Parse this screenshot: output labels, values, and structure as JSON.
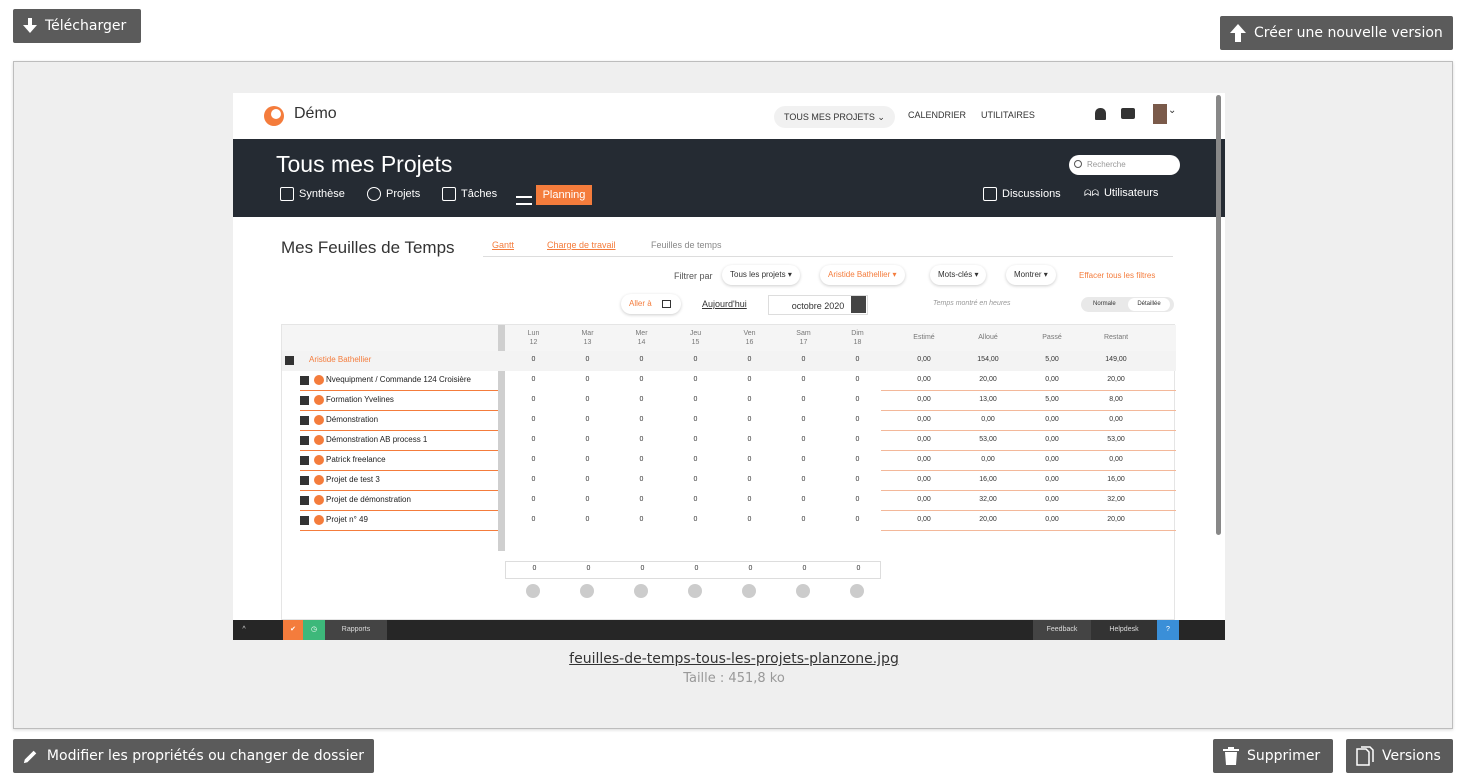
{
  "actions": {
    "download": "Télécharger",
    "new_version": "Créer une nouvelle version",
    "edit_props": "Modifier les propriétés ou changer de dossier",
    "delete": "Supprimer",
    "versions": "Versions"
  },
  "file": {
    "name": "feuilles-de-temps-tous-les-projets-planzone.jpg",
    "size": "Taille : 451,8 ko"
  },
  "preview": {
    "app_name": "Démo",
    "top_nav": {
      "projects": "TOUS MES PROJETS",
      "calendar": "CALENDRIER",
      "utilities": "UTILITAIRES"
    },
    "title": "Tous mes Projets",
    "search_placeholder": "Recherche",
    "nav": [
      "Synthèse",
      "Projets",
      "Tâches",
      "Planning"
    ],
    "nav_right": [
      "Discussions",
      "Utilisateurs"
    ],
    "section_title": "Mes Feuilles de Temps",
    "tabs": [
      "Gantt",
      "Charge de travail",
      "Feuilles de temps"
    ],
    "filter_label": "Filtrer par",
    "filters": [
      "Tous les projets",
      "Aristide Bathellier",
      "Mots-clés",
      "Montrer"
    ],
    "clear_filters": "Effacer tous les filtres",
    "goto": "Aller à",
    "today": "Aujourd'hui",
    "month": "octobre 2020",
    "time_note": "Temps montré en heures",
    "toggle": [
      "Normale",
      "Détaillée"
    ],
    "days": [
      {
        "d": "Lun",
        "n": "12"
      },
      {
        "d": "Mar",
        "n": "13"
      },
      {
        "d": "Mer",
        "n": "14"
      },
      {
        "d": "Jeu",
        "n": "15"
      },
      {
        "d": "Ven",
        "n": "16"
      },
      {
        "d": "Sam",
        "n": "17"
      },
      {
        "d": "Dim",
        "n": "18"
      }
    ],
    "sum_headers": [
      "Estimé",
      "Alloué",
      "Passé",
      "Restant"
    ],
    "owner": {
      "name": "Aristide Bathellier",
      "days": [
        "0",
        "0",
        "0",
        "0",
        "0",
        "0",
        "0"
      ],
      "sums": [
        "0,00",
        "154,00",
        "5,00",
        "149,00"
      ]
    },
    "rows": [
      {
        "name": "Nvequipment / Commande 124 Croisière",
        "sums": [
          "0,00",
          "20,00",
          "0,00",
          "20,00"
        ]
      },
      {
        "name": "Formation Yvelines",
        "sums": [
          "0,00",
          "13,00",
          "5,00",
          "8,00"
        ]
      },
      {
        "name": "Démonstration",
        "sums": [
          "0,00",
          "0,00",
          "0,00",
          "0,00"
        ]
      },
      {
        "name": "Démonstration AB process 1",
        "sums": [
          "0,00",
          "53,00",
          "0,00",
          "53,00"
        ]
      },
      {
        "name": "Patrick freelance",
        "sums": [
          "0,00",
          "0,00",
          "0,00",
          "0,00"
        ]
      },
      {
        "name": "Projet de test 3",
        "sums": [
          "0,00",
          "16,00",
          "0,00",
          "16,00"
        ]
      },
      {
        "name": "Projet de démonstration",
        "sums": [
          "0,00",
          "32,00",
          "0,00",
          "32,00"
        ]
      },
      {
        "name": "Projet n° 49",
        "sums": [
          "0,00",
          "20,00",
          "0,00",
          "20,00"
        ]
      }
    ],
    "day_value": "0",
    "totals": [
      "0",
      "0",
      "0",
      "0",
      "0",
      "0",
      "0"
    ],
    "bottom_bar": {
      "reports": "Rapports",
      "feedback": "Feedback",
      "helpdesk": "Helpdesk"
    },
    "colors": {
      "accent": "#f47c3c",
      "dark": "#252b33"
    }
  }
}
